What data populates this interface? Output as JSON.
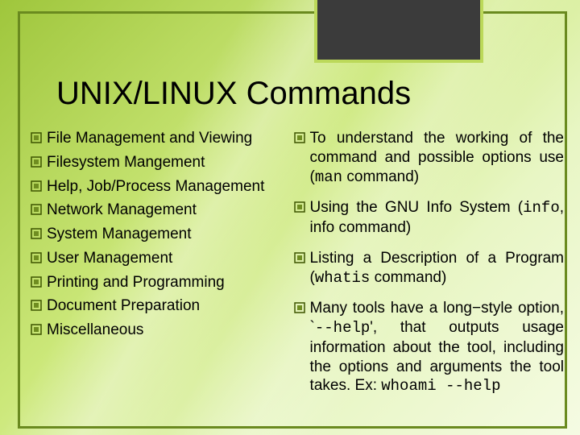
{
  "title": "UNIX/LINUX Commands",
  "left_column": [
    "File Management and Viewing",
    "Filesystem Mangement",
    "Help, Job/Process Management",
    "Network Management",
    "System Management",
    "User Management",
    "Printing and Programming",
    "Document Preparation",
    "Miscellaneous"
  ],
  "right_column": [
    {
      "pre": "To understand the working of the command and possible options use (",
      "code": "man",
      "post": " command)"
    },
    {
      "pre": " Using the GNU Info System (",
      "code": "info",
      "post": ", info command)"
    },
    {
      "pre": "Listing a Description of a Program (",
      "code": "whatis",
      "post": " command)"
    },
    {
      "pre": "Many tools have a long−style option, `",
      "code": "--help",
      "post": "', that outputs usage information about the tool, including the options and arguments the tool takes. Ex: ",
      "code2": "whoami --help"
    }
  ],
  "colors": {
    "bullet_fill": "#6f8d20",
    "bullet_edge": "#3d5400"
  }
}
